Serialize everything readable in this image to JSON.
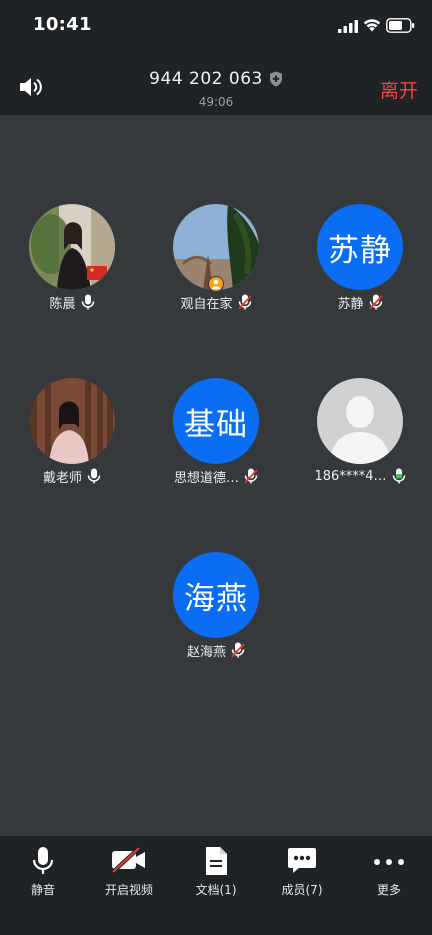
{
  "status_bar": {
    "time": "10:41"
  },
  "header": {
    "meeting_id": "944 202 063",
    "duration": "49:06",
    "leave_label": "离开"
  },
  "participants": [
    {
      "name": "陈晨",
      "avatar_type": "photo",
      "mic": "on"
    },
    {
      "name": "观自在家",
      "avatar_type": "photo",
      "mic": "muted",
      "host": true
    },
    {
      "name": "苏静",
      "avatar_type": "text",
      "avatar_text": "苏静",
      "mic": "muted"
    },
    {
      "name": "戴老师",
      "avatar_type": "photo",
      "mic": "on"
    },
    {
      "name": "思想道德…",
      "avatar_type": "text",
      "avatar_text": "基础",
      "mic": "muted"
    },
    {
      "name": "186****4…",
      "avatar_type": "placeholder",
      "mic": "speaking"
    },
    {
      "name": "赵海燕",
      "avatar_type": "text",
      "avatar_text": "海燕",
      "mic": "muted"
    }
  ],
  "toolbar": {
    "mute_label": "静音",
    "video_label": "开启视频",
    "docs_label": "文档(1)",
    "members_label": "成员(7)",
    "more_label": "更多"
  },
  "colors": {
    "background": "#36393c",
    "bar": "#202326",
    "avatar_blue": "#0a6df3",
    "leave_red": "#f0453c",
    "host_badge": "#f4a51c",
    "muted_red": "#e53935",
    "speaking_green": "#3ec55a"
  }
}
